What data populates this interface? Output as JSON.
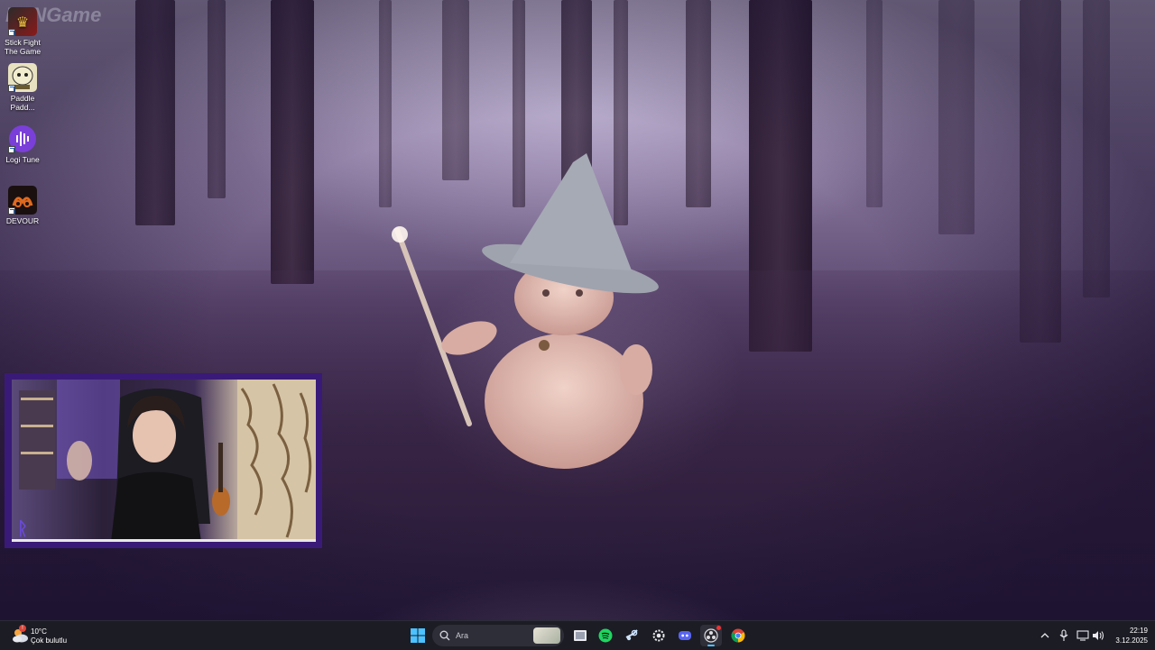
{
  "desktop": {
    "icons": [
      {
        "label": "Stick Fight The Game",
        "icon": "stick-fight-game-icon"
      },
      {
        "label": "Paddle Padd...",
        "icon": "paddle-paddle-icon"
      },
      {
        "label": "Logi Tune",
        "icon": "logi-tune-icon"
      },
      {
        "label": "DEVOUR",
        "icon": "devour-icon"
      }
    ],
    "watermark": "BoNGame"
  },
  "taskbar": {
    "weather": {
      "temperature": "10°C",
      "condition": "Çok bulutlu",
      "icon": "cloud-sun-icon"
    },
    "search_placeholder": "Ara",
    "apps": [
      "windows-start-icon",
      "search-icon",
      "task-view-icon",
      "spotify-icon",
      "steam-icon",
      "settings-icon",
      "discord-icon",
      "obs-icon",
      "chrome-icon"
    ],
    "tray": {
      "time": "22:19",
      "date": "3.12.2025"
    }
  },
  "colors": {
    "accent": "#3a1a78",
    "taskbar": "#1c1c24"
  }
}
